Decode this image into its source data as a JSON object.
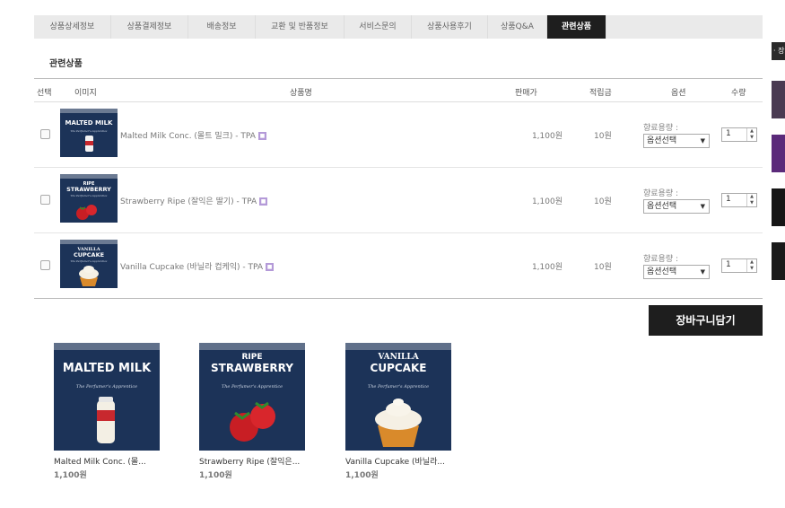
{
  "tabs": [
    {
      "label": "상품상세정보",
      "active": false
    },
    {
      "label": "상품결제정보",
      "active": false
    },
    {
      "label": "배송정보",
      "active": false
    },
    {
      "label": "교환 및 반품정보",
      "active": false
    },
    {
      "label": "서비스문의",
      "active": false
    },
    {
      "label": "상품사용후기",
      "active": false
    },
    {
      "label": "상품Q&A",
      "active": false
    },
    {
      "label": "관련상품",
      "active": true
    }
  ],
  "section_title": "관련상품",
  "table": {
    "headers": {
      "select": "선택",
      "image": "이미지",
      "name": "상품명",
      "price": "판매가",
      "points": "적립금",
      "option": "옵션",
      "qty": "수량"
    },
    "rows": [
      {
        "name": "Malted Milk Conc. (몰트 밀크) - TPA",
        "price": "1,100원",
        "points": "10원",
        "option_label": "향료용량 :",
        "option_value": "옵션선택",
        "qty": "1",
        "img_top": "MALTED MILK",
        "img_bottom": ""
      },
      {
        "name": "Strawberry Ripe (잘익은 딸기) - TPA",
        "price": "1,100원",
        "points": "10원",
        "option_label": "향료용량 :",
        "option_value": "옵션선택",
        "qty": "1",
        "img_top": "RIPE",
        "img_bottom": "STRAWBERRY"
      },
      {
        "name": "Vanilla Cupcake (바닐라 컵케익) - TPA",
        "price": "1,100원",
        "points": "10원",
        "option_label": "향료용량 :",
        "option_value": "옵션선택",
        "qty": "1",
        "img_top": "VANILLA",
        "img_bottom": "CUPCAKE"
      }
    ]
  },
  "cart_button": "장바구니담기",
  "cards": [
    {
      "name": "Malted Milk Conc. (몰...",
      "price": "1,100원",
      "img_top": "MALTED MILK",
      "img_bottom": ""
    },
    {
      "name": "Strawberry Ripe (잘익은...",
      "price": "1,100원",
      "img_top": "RIPE",
      "img_bottom": "STRAWBERRY"
    },
    {
      "name": "Vanilla Cupcake (바닐라...",
      "price": "1,100원",
      "img_top": "VANILLA",
      "img_bottom": "CUPCAKE"
    }
  ],
  "img_tagline": "The Perfumer's Apprentice",
  "side_label": "· 장",
  "colors": {
    "navy": "#1c3358",
    "dark": "#1e1e1e",
    "tab_bg": "#eaeaea",
    "mark": "#b49ad8"
  }
}
